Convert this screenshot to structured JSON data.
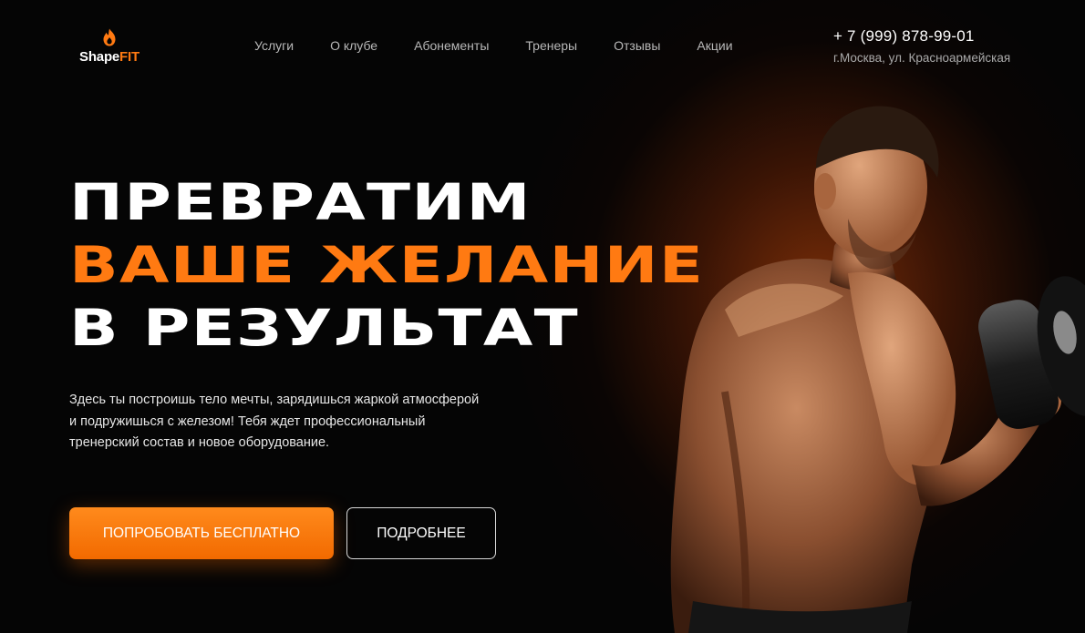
{
  "brand": {
    "name_part1": "Shape",
    "name_part2": "FIT",
    "accent_color": "#ff7a12",
    "icon": "flame-icon"
  },
  "nav": {
    "items": [
      {
        "label": "Услуги"
      },
      {
        "label": "О клубе"
      },
      {
        "label": "Абонементы"
      },
      {
        "label": "Тренеры"
      },
      {
        "label": "Отзывы"
      },
      {
        "label": "Акции"
      }
    ]
  },
  "contacts": {
    "phone": "+ 7 (999) 878-99-01",
    "address": "г.Москва, ул. Красноармейская"
  },
  "hero": {
    "headline_line1": "ПРЕВРАТИМ",
    "headline_line2": "ВАШЕ ЖЕЛАНИЕ",
    "headline_line3": "В РЕЗУЛЬТАТ",
    "description_line1": "Здесь ты построишь тело мечты, зарядишься жаркой атмосферой",
    "description_line2": "и подружишься с железом! Тебя ждет профессиональный",
    "description_line3": "тренерский состав и новое оборудование.",
    "primary_button": "ПОПРОБОВАТЬ БЕСПЛАТНО",
    "secondary_button": "ПОДРОБНЕЕ",
    "image": "athlete-with-dumbbell"
  }
}
